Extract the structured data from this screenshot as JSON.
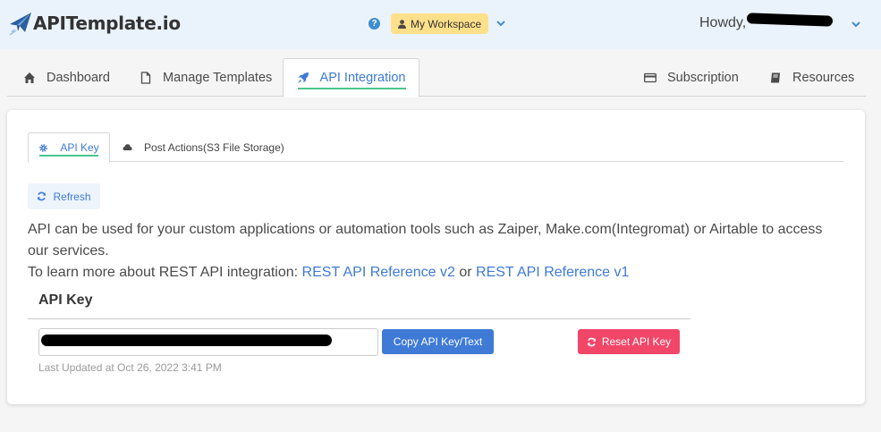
{
  "header": {
    "logo_text": "APITemplate.io",
    "workspace_label": "My Workspace",
    "howdy_label": "Howdy,"
  },
  "main_tabs": [
    {
      "label": "Dashboard",
      "icon": "home-icon"
    },
    {
      "label": "Manage Templates",
      "icon": "file-icon"
    },
    {
      "label": "API Integration",
      "icon": "rocket-icon",
      "active": true
    },
    {
      "label": "Subscription",
      "icon": "credit-card-icon"
    },
    {
      "label": "Resources",
      "icon": "book-icon"
    }
  ],
  "sub_tabs": [
    {
      "label": "API Key",
      "icon": "gear-icon",
      "active": true
    },
    {
      "label": "Post Actions(S3 File Storage)",
      "icon": "cloud-icon"
    }
  ],
  "refresh_label": "Refresh",
  "description": {
    "line1": "API can be used for your custom applications or automation tools such as Zaiper, Make.com(Integromat) or Airtable to access our services.",
    "line2_prefix": "To learn more about REST API integration: ",
    "link_v2": "REST API Reference v2",
    "connector": " or ",
    "link_v1": "REST API Reference v1"
  },
  "api_key_section": {
    "title": "API Key",
    "copy_label": "Copy API Key/Text",
    "reset_label": "Reset API Key",
    "last_updated": "Last Updated at Oct 26, 2022 3:41 PM"
  },
  "colors": {
    "accent_blue": "#3e7ad6",
    "active_underline": "#48c78e",
    "danger": "#f14668",
    "workspace_bg": "#ffe08a",
    "topbar_bg": "#eaf3fb"
  }
}
